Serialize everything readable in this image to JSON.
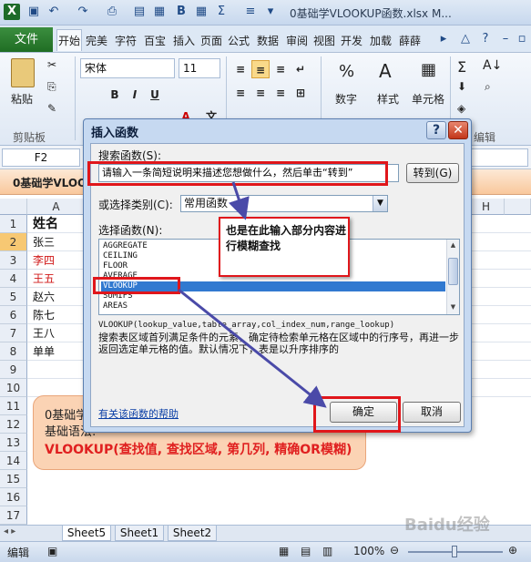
{
  "window": {
    "title": "0基础学VLOOKUP函数.xlsx M..."
  },
  "ribbon": {
    "file_tab": "文件",
    "tabs": [
      "开始",
      "完美",
      "字符",
      "百宝",
      "插入",
      "页面",
      "公式",
      "数据",
      "审阅",
      "视图",
      "开发",
      "加载",
      "薛薛"
    ],
    "font_name": "宋体",
    "font_size": "11",
    "paste_label": "粘贴",
    "clipboard_group": "剪贴板",
    "number_label": "数字",
    "style_label": "样式",
    "cells_label": "单元格",
    "edit_label": "编辑"
  },
  "formula_bar": {
    "name_box": "F2"
  },
  "sheet": {
    "doc_tab": "0基础学VLOOKUP函数",
    "col_headers": [
      "A",
      "H"
    ],
    "row_numbers": [
      "1",
      "2",
      "3",
      "4",
      "5",
      "6",
      "7",
      "8",
      "9",
      "10",
      "11",
      "12",
      "13",
      "14",
      "15",
      "16",
      "17"
    ],
    "header_cell": "姓名",
    "names": [
      "张三",
      "李四",
      "王五",
      "赵六",
      "陈七",
      "王八",
      "单单"
    ],
    "tabs": [
      "Sheet5",
      "Sheet1",
      "Sheet2"
    ]
  },
  "callout": {
    "line1": "0基础学",
    "line2": "基础语法:",
    "line3": "VLOOKUP(查找值, 查找区域, 第几列, 精确OR模糊)"
  },
  "dialog": {
    "title": "插入函数",
    "help_button": "?",
    "close_button": "✕",
    "search_label": "搜索函数(S):",
    "search_value": "请输入一条简短说明来描述您想做什么，然后单击“转到”",
    "goto_button": "转到(G)",
    "category_label": "或选择类别(C):",
    "category_value": "常用函数",
    "select_label": "选择函数(N):",
    "functions": [
      "AGGREGATE",
      "CEILING",
      "FLOOR",
      "AVERAGE",
      "VLOOKUP",
      "SUMIFS",
      "AREAS"
    ],
    "selected_function": "VLOOKUP",
    "signature": "VLOOKUP(lookup_value,table_array,col_index_num,range_lookup)",
    "description": "搜索表区域首列满足条件的元素，确定待检索单元格在区域中的行序号，再进一步返回选定单元格的值。默认情况下，表是以升序排序的",
    "help_link": "有关该函数的帮助",
    "ok_button": "确定",
    "cancel_button": "取消"
  },
  "annotation": {
    "note": "也是在此输入部分内容进行模糊查找"
  },
  "status": {
    "mode": "编辑",
    "zoom": "100%"
  },
  "watermark": "Baidu经验"
}
